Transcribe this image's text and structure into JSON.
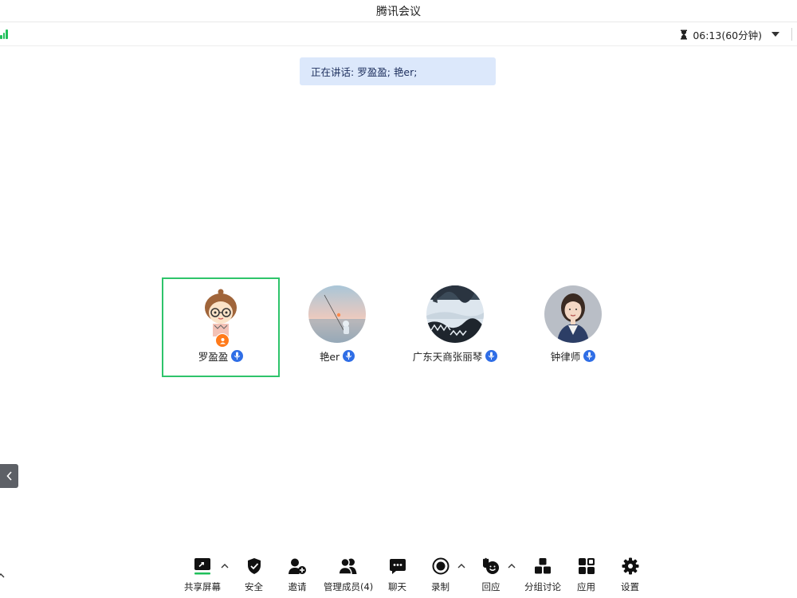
{
  "window": {
    "title": "腾讯会议"
  },
  "infobar": {
    "timer_text": "06:13(60分钟)"
  },
  "speaking": {
    "prefix": "正在讲话:",
    "names": "罗盈盈; 艳er;"
  },
  "participants": [
    {
      "name": "罗盈盈",
      "active": true,
      "host": true
    },
    {
      "name": "艳er",
      "active": false
    },
    {
      "name": "广东天商张丽琴",
      "active": false
    },
    {
      "name": "钟律师",
      "active": false
    }
  ],
  "toolbar": {
    "share_screen": "共享屏幕",
    "security": "安全",
    "invite": "邀请",
    "manage_members": "管理成员(4)",
    "chat": "聊天",
    "record": "录制",
    "react": "回应",
    "breakout": "分组讨论",
    "apps": "应用",
    "settings": "设置"
  },
  "colors": {
    "accent_green": "#2ec46b",
    "mic_blue": "#2f6ee6",
    "banner_bg": "#dce8fb",
    "host_orange": "#ff7a1a"
  }
}
